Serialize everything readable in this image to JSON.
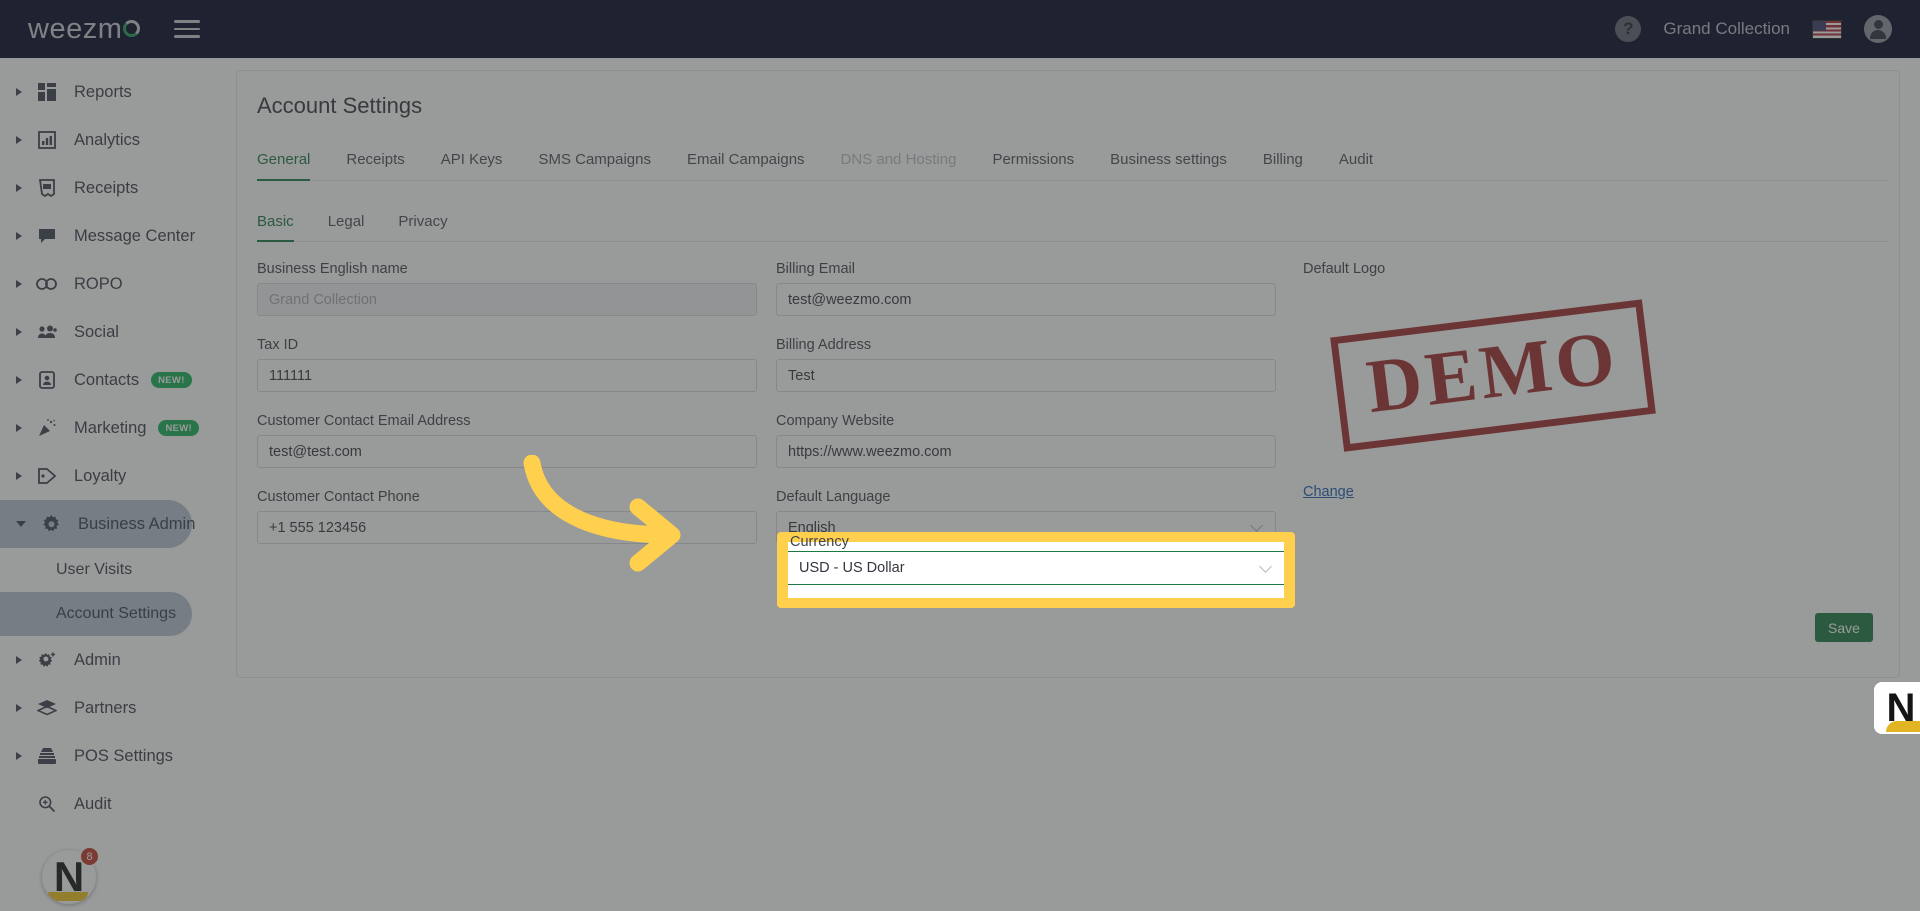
{
  "topbar": {
    "brand": "weezm",
    "menu_icon": "hamburger-icon",
    "help_icon": "?",
    "account_name": "Grand Collection",
    "flag": "us-flag-icon",
    "user_icon": "user-avatar-icon"
  },
  "sidebar": {
    "items": [
      {
        "label": "Reports",
        "icon": "dashboard-icon",
        "badge": "",
        "expandable": true,
        "active": false
      },
      {
        "label": "Analytics",
        "icon": "chart-icon",
        "badge": "",
        "expandable": true,
        "active": false
      },
      {
        "label": "Receipts",
        "icon": "receipt-icon",
        "badge": "",
        "expandable": true,
        "active": false
      },
      {
        "label": "Message Center",
        "icon": "chat-icon",
        "badge": "",
        "expandable": true,
        "active": false
      },
      {
        "label": "ROPO",
        "icon": "infinity-icon",
        "badge": "",
        "expandable": true,
        "active": false
      },
      {
        "label": "Social",
        "icon": "people-icon",
        "badge": "",
        "expandable": true,
        "active": false
      },
      {
        "label": "Contacts",
        "icon": "contact-card-icon",
        "badge": "NEW!",
        "expandable": true,
        "active": false
      },
      {
        "label": "Marketing",
        "icon": "megaphone-icon",
        "badge": "NEW!",
        "expandable": true,
        "active": false
      },
      {
        "label": "Loyalty",
        "icon": "tag-icon",
        "badge": "",
        "expandable": true,
        "active": false
      },
      {
        "label": "Business Admin",
        "icon": "gear-icon",
        "badge": "",
        "expandable": true,
        "active": true
      }
    ],
    "sub_items": [
      {
        "label": "User Visits",
        "active": false
      },
      {
        "label": "Account Settings",
        "active": true
      }
    ],
    "items_after": [
      {
        "label": "Admin",
        "icon": "gear-plus-icon",
        "badge": "",
        "expandable": true,
        "active": false
      },
      {
        "label": "Partners",
        "icon": "layers-icon",
        "badge": "",
        "expandable": true,
        "active": false
      },
      {
        "label": "POS Settings",
        "icon": "pos-icon",
        "badge": "",
        "expandable": true,
        "active": false
      },
      {
        "label": "Audit",
        "icon": "search-plus-icon",
        "badge": "",
        "expandable": false,
        "active": false
      }
    ],
    "notification_logo": {
      "letter": "N",
      "count": "8"
    }
  },
  "main": {
    "page_title": "Account Settings",
    "tabs": [
      {
        "label": "General",
        "active": true,
        "disabled": false
      },
      {
        "label": "Receipts",
        "active": false,
        "disabled": false
      },
      {
        "label": "API Keys",
        "active": false,
        "disabled": false
      },
      {
        "label": "SMS Campaigns",
        "active": false,
        "disabled": false
      },
      {
        "label": "Email Campaigns",
        "active": false,
        "disabled": false
      },
      {
        "label": "DNS and Hosting",
        "active": false,
        "disabled": true
      },
      {
        "label": "Permissions",
        "active": false,
        "disabled": false
      },
      {
        "label": "Business settings",
        "active": false,
        "disabled": false
      },
      {
        "label": "Billing",
        "active": false,
        "disabled": false
      },
      {
        "label": "Audit",
        "active": false,
        "disabled": false
      }
    ],
    "subtabs": [
      {
        "label": "Basic",
        "active": true
      },
      {
        "label": "Legal",
        "active": false
      },
      {
        "label": "Privacy",
        "active": false
      }
    ],
    "fields": {
      "business_name": {
        "label": "Business English name",
        "value": "",
        "placeholder": "Grand Collection",
        "disabled": true
      },
      "tax_id": {
        "label": "Tax ID",
        "value": "111111"
      },
      "contact_email": {
        "label": "Customer Contact Email Address",
        "value": "test@test.com"
      },
      "contact_phone": {
        "label": "Customer Contact Phone",
        "value": "+1 555 123456"
      },
      "billing_email": {
        "label": "Billing Email",
        "value": "test@weezmo.com"
      },
      "billing_address": {
        "label": "Billing Address",
        "value": "Test"
      },
      "company_website": {
        "label": "Company Website",
        "value": "https://www.weezmo.com"
      },
      "default_language": {
        "label": "Default Language",
        "value": "English"
      },
      "currency": {
        "label": "Currency",
        "value": "USD - US Dollar"
      }
    },
    "logo": {
      "label": "Default Logo",
      "stamp_text": "DEMO",
      "change_label": "Change"
    },
    "save_label": "Save"
  },
  "floating_widget": {
    "letter": "N"
  },
  "colors": {
    "navy": "#000725",
    "green": "#1b7a43",
    "highlight_yellow": "#ffd04d",
    "badge_green": "#13b257",
    "link_blue": "#1a5fb4",
    "stamp_red": "#9b1b1b",
    "sidebar_active": "#b9c2d4"
  }
}
